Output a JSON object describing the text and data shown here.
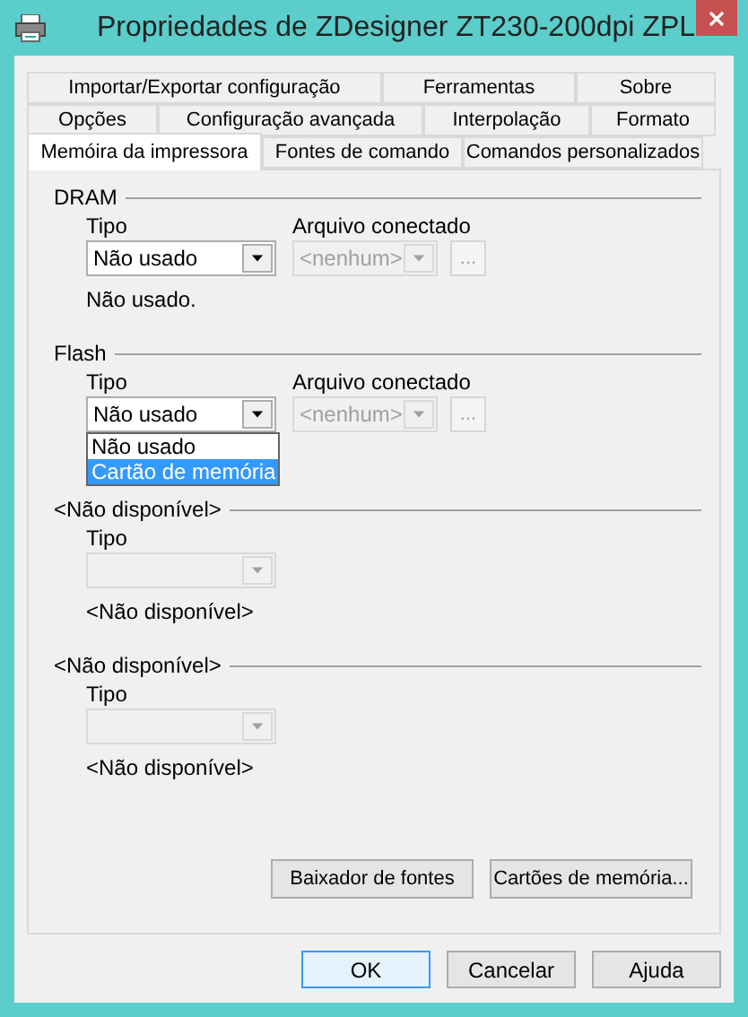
{
  "window": {
    "title": "Propriedades de ZDesigner ZT230-200dpi ZPL"
  },
  "tab_rows": [
    [
      {
        "label": "Importar/Exportar configuração",
        "selected": false
      },
      {
        "label": "Ferramentas",
        "selected": false
      },
      {
        "label": "Sobre",
        "selected": false
      }
    ],
    [
      {
        "label": "Opções",
        "selected": false
      },
      {
        "label": "Configuração avançada",
        "selected": false
      },
      {
        "label": "Interpolação",
        "selected": false
      },
      {
        "label": "Formato",
        "selected": false
      }
    ],
    [
      {
        "label": "Memóira da impressora",
        "selected": true
      },
      {
        "label": "Fontes de comando",
        "selected": false
      },
      {
        "label": "Comandos personalizados",
        "selected": false
      }
    ]
  ],
  "sections": [
    {
      "kind": "memory",
      "header": "DRAM",
      "type_label": "Tipo",
      "type_combo": {
        "value": "Não usado",
        "disabled": false
      },
      "file_label": "Arquivo conectado",
      "file_combo": {
        "value": "<nenhum>",
        "disabled": true
      },
      "browse": "...",
      "status": "Não usado."
    },
    {
      "kind": "memory",
      "header": "Flash",
      "type_label": "Tipo",
      "type_combo": {
        "value": "Não usado",
        "disabled": false
      },
      "file_label": "Arquivo conectado",
      "file_combo": {
        "value": "<nenhum>",
        "disabled": true
      },
      "browse": "...",
      "dropdown": [
        {
          "label": "Não usado",
          "selected": false
        },
        {
          "label": "Cartão de memória",
          "selected": true
        }
      ]
    },
    {
      "kind": "unavailable",
      "header": "<Não disponível>",
      "type_label": "Tipo",
      "type_combo": {
        "disabled": true
      },
      "status": "<Não disponível>"
    },
    {
      "kind": "unavailable",
      "header": "<Não disponível>",
      "type_label": "Tipo",
      "type_combo": {
        "disabled": true
      },
      "status": "<Não disponível>"
    }
  ],
  "panel_buttons": [
    "Baixador de fontes",
    "Cartões de memória..."
  ],
  "dialog_buttons": [
    {
      "label": "OK",
      "default": true
    },
    {
      "label": "Cancelar",
      "default": false
    },
    {
      "label": "Ajuda",
      "default": false
    }
  ]
}
